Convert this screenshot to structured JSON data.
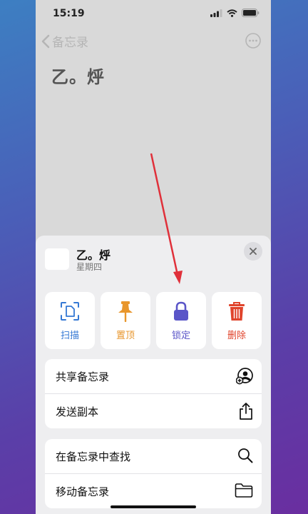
{
  "status": {
    "time": "15:19"
  },
  "nav": {
    "back_label": "备忘录"
  },
  "note": {
    "title": "乙。烀",
    "date": "星期四"
  },
  "actions": [
    {
      "label": "扫描",
      "color": "#3478d4",
      "icon": "scan-document-icon"
    },
    {
      "label": "置顶",
      "color": "#e8962c",
      "icon": "pin-icon"
    },
    {
      "label": "锁定",
      "color": "#5a55c8",
      "icon": "lock-icon"
    },
    {
      "label": "删除",
      "color": "#e0442c",
      "icon": "trash-icon"
    }
  ],
  "menu_group1": [
    {
      "label": "共享备忘录",
      "icon": "share-person-icon"
    },
    {
      "label": "发送副本",
      "icon": "share-out-icon"
    }
  ],
  "menu_group2": [
    {
      "label": "在备忘录中查找",
      "icon": "search-icon"
    },
    {
      "label": "移动备忘录",
      "icon": "folder-icon"
    }
  ]
}
